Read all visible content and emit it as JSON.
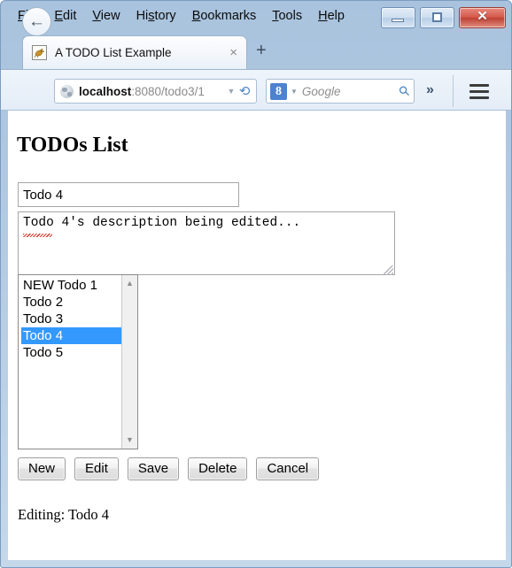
{
  "browser": {
    "menu": [
      {
        "label": "File",
        "accel": "F"
      },
      {
        "label": "Edit",
        "accel": "E"
      },
      {
        "label": "View",
        "accel": "V"
      },
      {
        "label": "History",
        "accel": "s"
      },
      {
        "label": "Bookmarks",
        "accel": "B"
      },
      {
        "label": "Tools",
        "accel": "T"
      },
      {
        "label": "Help",
        "accel": "H"
      }
    ],
    "window_controls": {
      "minimize_label": "–",
      "maximize_label": "□",
      "close_label": "✕"
    },
    "tab": {
      "title": "A TODO List Example",
      "close_label": "×",
      "favicon_name": "tomcat-favicon"
    },
    "new_tab_label": "+",
    "nav": {
      "back_label": "←",
      "url_host": "localhost",
      "url_path": ":8080/todo3/1",
      "url_full": "localhost:8080/todo3/1",
      "url_dropdown_label": "▼",
      "reload_label": "⟳",
      "search_engine": "Google",
      "search_badge": "8",
      "search_placeholder": "Google",
      "search_dropdown_label": "▼",
      "overflow_label": "»",
      "menu_button_name": "hamburger-menu"
    }
  },
  "page": {
    "title": "TODOs List",
    "title_input_value": "Todo 4",
    "title_input_placeholder": "",
    "description_value": "Todo 4's description being edited...",
    "description_placeholder": "",
    "list": {
      "items": [
        {
          "label": "NEW Todo 1",
          "selected": false
        },
        {
          "label": "Todo 2",
          "selected": false
        },
        {
          "label": "Todo 3",
          "selected": false
        },
        {
          "label": "Todo 4",
          "selected": true
        },
        {
          "label": "Todo 5",
          "selected": false
        }
      ],
      "scroll_up_label": "▲",
      "scroll_down_label": "▼",
      "selected_value": "Todo 4",
      "selection_color": "#3399ff"
    },
    "buttons": [
      {
        "label": "New"
      },
      {
        "label": "Edit"
      },
      {
        "label": "Save"
      },
      {
        "label": "Delete"
      },
      {
        "label": "Cancel"
      }
    ],
    "status": "Editing: Todo 4"
  }
}
